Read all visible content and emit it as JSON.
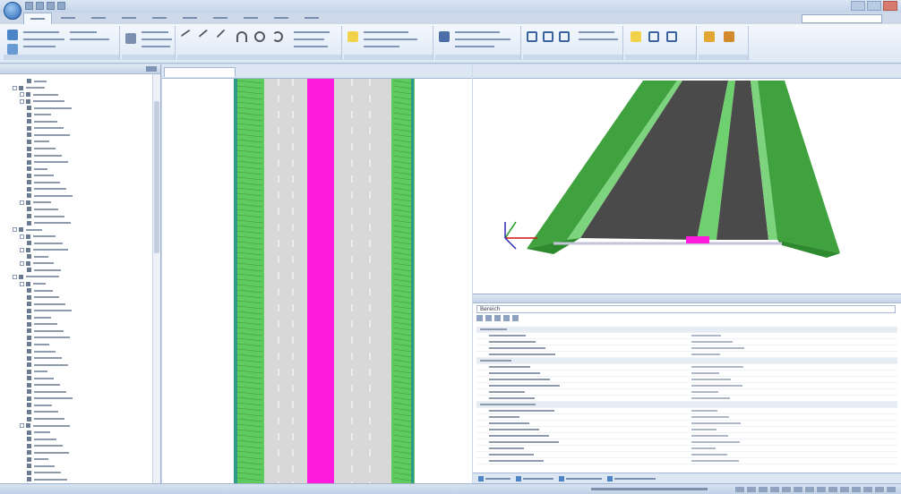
{
  "ribbon": {
    "tab_count": 10,
    "group_count": 8
  },
  "tree": {
    "row_count": 60
  },
  "properties": {
    "selection_value": "Bereich",
    "row_count": 22,
    "tab_count": 4
  },
  "colors": {
    "median_magenta": "#ff1bdc",
    "verge_green": "#5ecb5e",
    "asphalt": "#4a4a4a",
    "road_light": "#d8d8d8",
    "axis_red": "#d01414",
    "axis_green": "#1a9a1a",
    "axis_blue": "#2a2ab0"
  }
}
